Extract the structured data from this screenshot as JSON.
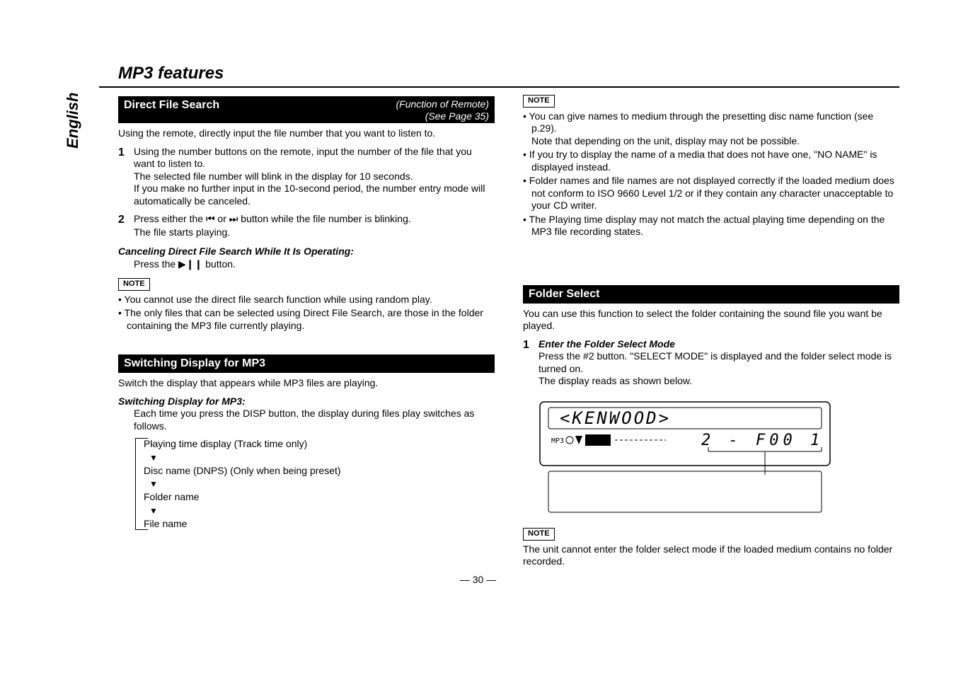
{
  "sidebar_lang": "English",
  "page_title": "MP3 features",
  "page_number": "— 30 —",
  "left": {
    "section1": {
      "title": "Direct File Search",
      "fn1": "(Function of Remote)",
      "fn2": "(See Page 35)",
      "intro": "Using the remote, directly input the file number that you want to listen to.",
      "steps": {
        "n1": "1",
        "n2": "2",
        "s1a": "Using the number buttons on the remote, input the number of the file that you want to listen to.",
        "s1b": "The selected file number will blink in the display for 10 seconds.",
        "s1c": "If you make no further input in the 10-second period, the number entry mode will automatically be canceled.",
        "s2a_pre": "Press either the ",
        "s2a_mid1": "⏮",
        "s2a_or": " or ",
        "s2a_mid2": "⏭",
        "s2a_post": " button while the file number is blinking.",
        "s2b": "The file starts playing."
      },
      "cancel_head": "Canceling Direct File Search While It Is Operating:",
      "cancel_body_pre": "Press the ",
      "cancel_body_sym": "▶❙❙",
      "cancel_body_post": " button.",
      "note_label": "NOTE",
      "bullets": [
        "You cannot use the direct file search function while using random play.",
        "The only files that can be selected using Direct File Search, are those in the folder containing the MP3 file currently playing."
      ]
    },
    "section2": {
      "title": "Switching Display for MP3",
      "intro": "Switch the display that appears while MP3 files are playing.",
      "subhead": "Switching Display for MP3:",
      "body": "Each time you press the DISP button, the display during files play switches as follows.",
      "flow": [
        "Playing time display (Track time only)",
        "Disc name (DNPS) (Only when being preset)",
        "Folder name",
        "File name"
      ]
    }
  },
  "right": {
    "note_label": "NOTE",
    "bullets": [
      "You can give names to medium through the presetting disc name function (see p.29).\nNote that depending on the unit, display may not be possible.",
      "If you try to display the name of a media that does not have one, \"NO NAME\" is displayed instead.",
      "Folder names and file names are not displayed correctly if the loaded medium does not conform to ISO 9660 Level 1/2 or if they contain any character unacceptable to your CD writer.",
      "The Playing time display may not match the actual playing time depending on the MP3 file recording states."
    ],
    "section3": {
      "title": "Folder Select",
      "intro": "You can use this function to select the folder containing the sound file you want be played.",
      "n1": "1",
      "step_head": "Enter the Folder Select Mode",
      "step_a": "Press the #2 button. \"SELECT MODE\" is displayed and the folder select mode is turned on.",
      "step_b": "The display reads as shown below.",
      "lcd_top": "<KENWOOD>",
      "lcd_bottom_right": "2  -  F 0 0 1",
      "lcd_small": "MP3",
      "note_label": "NOTE",
      "note_text": "The unit cannot enter the folder select mode if the loaded medium contains no folder recorded."
    }
  }
}
